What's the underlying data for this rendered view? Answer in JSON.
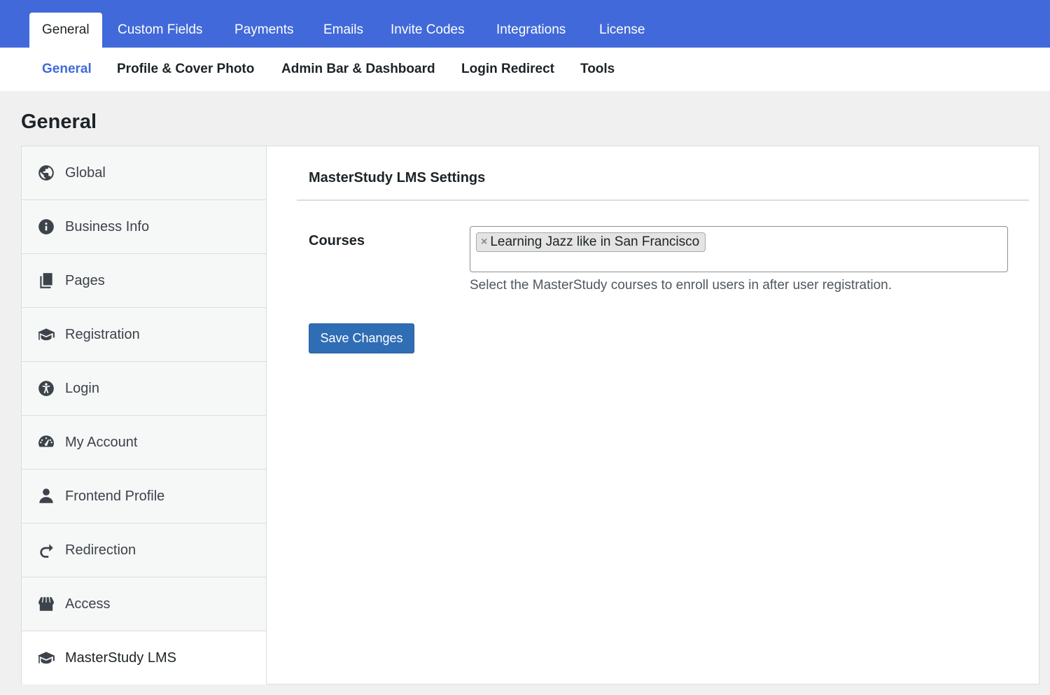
{
  "top_tabs": [
    {
      "label": "General",
      "active": true
    },
    {
      "label": "Custom Fields"
    },
    {
      "label": "Payments"
    },
    {
      "label": "Emails"
    },
    {
      "label": "Invite Codes"
    },
    {
      "label": "Integrations"
    },
    {
      "label": "License"
    }
  ],
  "sub_tabs": [
    {
      "label": "General",
      "active": true
    },
    {
      "label": "Profile & Cover Photo"
    },
    {
      "label": "Admin Bar & Dashboard"
    },
    {
      "label": "Login Redirect"
    },
    {
      "label": "Tools"
    }
  ],
  "page_title": "General",
  "sidebar": {
    "items": [
      {
        "label": "Global",
        "icon": "globe-icon"
      },
      {
        "label": "Business Info",
        "icon": "info-icon"
      },
      {
        "label": "Pages",
        "icon": "pages-icon"
      },
      {
        "label": "Registration",
        "icon": "graduation-cap-icon"
      },
      {
        "label": "Login",
        "icon": "accessibility-icon"
      },
      {
        "label": "My Account",
        "icon": "dashboard-icon"
      },
      {
        "label": "Frontend Profile",
        "icon": "user-icon"
      },
      {
        "label": "Redirection",
        "icon": "redo-icon"
      },
      {
        "label": "Access",
        "icon": "store-icon"
      },
      {
        "label": "MasterStudy LMS",
        "icon": "graduation-cap-icon",
        "active": true
      }
    ]
  },
  "content": {
    "section_title": "MasterStudy LMS Settings",
    "courses_field": {
      "label": "Courses",
      "selected": [
        "Learning Jazz like in San Francisco"
      ],
      "remove_symbol": "×",
      "description": "Select the MasterStudy courses to enroll users in after user registration."
    },
    "save_button": "Save Changes"
  },
  "colors": {
    "top_bar": "#4169d9",
    "active_sub_tab": "#3f6ad8",
    "save_button": "#2f6db5"
  }
}
